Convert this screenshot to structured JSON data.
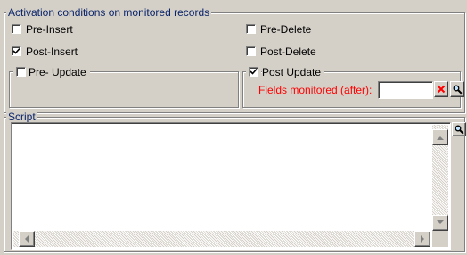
{
  "activation": {
    "title": "Activation conditions on monitored records",
    "pre_insert": {
      "label": "Pre-Insert",
      "checked": false
    },
    "post_insert": {
      "label": "Post-Insert",
      "checked": true
    },
    "pre_delete": {
      "label": "Pre-Delete",
      "checked": false
    },
    "post_delete": {
      "label": "Post-Delete",
      "checked": false
    },
    "pre_update": {
      "label": "Pre- Update",
      "checked": false
    },
    "post_update": {
      "label": "Post Update",
      "checked": true,
      "fields_label": "Fields monitored (after):",
      "fields_value": ""
    }
  },
  "script": {
    "title": "Script",
    "value": ""
  },
  "colors": {
    "dialog_bg": "#d4d0c8",
    "groupbox_title": "#0a246a",
    "fields_label": "#ff0000",
    "clear_icon": "#ff0000"
  },
  "icons": {
    "clear": "red-x-icon",
    "search": "magnifier-icon",
    "scroll_up": "arrow-up-icon",
    "scroll_down": "arrow-down-icon",
    "scroll_left": "arrow-left-icon",
    "scroll_right": "arrow-right-icon"
  }
}
